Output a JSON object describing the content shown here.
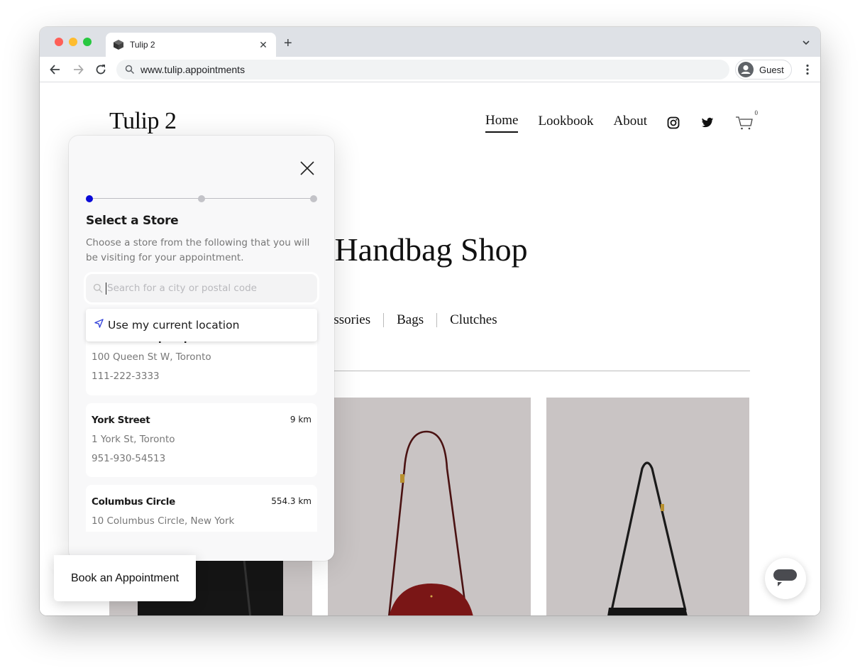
{
  "browser": {
    "tab_title": "Tulip 2",
    "url": "www.tulip.appointments",
    "profile_label": "Guest",
    "icons": {
      "favicon": "cube-icon",
      "tab_close": "close-icon",
      "new_tab": "plus-icon",
      "tab_menu": "chevron-down-icon",
      "back": "arrow-left-icon",
      "forward": "arrow-right-icon",
      "reload": "reload-icon",
      "omnibox": "search-icon",
      "profile": "person-icon",
      "menu": "kebab-icon"
    }
  },
  "site": {
    "logo": "Tulip 2",
    "nav": [
      {
        "label": "Home",
        "active": true
      },
      {
        "label": "Lookbook",
        "active": false
      },
      {
        "label": "About",
        "active": false
      }
    ],
    "social_icons": [
      "instagram-icon",
      "twitter-icon"
    ],
    "cart_count": "0",
    "hero_title": "The Handbag Shop",
    "hero_visible_title": "ne Handbag Shop",
    "categories": [
      "Accessories",
      "Bags",
      "Clutches"
    ],
    "book_button_label": "Book an Appointment",
    "chat_icon": "chat-bubble-icon"
  },
  "modal": {
    "title": "Select a Store",
    "description": "Choose a store from the following that you will be visiting for your appointment.",
    "steps": {
      "total": 3,
      "current": 1,
      "active_color": "#0a0ad8",
      "inactive_color": "#c3c3c8"
    },
    "search": {
      "placeholder": "Search for a city or postal code",
      "value": ""
    },
    "location_option": "Use my current location",
    "stores": [
      {
        "name": "Nathan Phillips Square",
        "distance": "",
        "address": "100 Queen St W, Toronto",
        "phone": "111-222-3333"
      },
      {
        "name": "York Street",
        "distance": "9 km",
        "address": "1 York St, Toronto",
        "phone": "951-930-54513"
      },
      {
        "name": "Columbus Circle",
        "distance": "554.3 km",
        "address": "10 Columbus Circle, New York",
        "phone": ""
      }
    ]
  }
}
